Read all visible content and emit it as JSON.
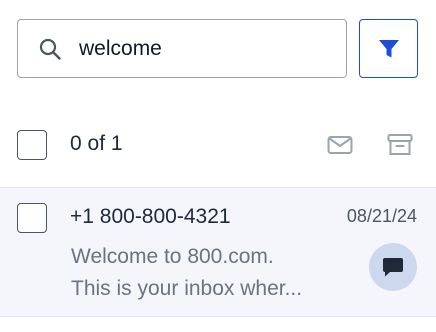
{
  "search": {
    "value": "welcome",
    "icon": "search-icon"
  },
  "filter": {
    "icon": "filter-icon",
    "color": "#1d4ed8"
  },
  "toolbar": {
    "count_label": "0 of 1",
    "icons": [
      "mail-icon",
      "archive-icon"
    ]
  },
  "messages": [
    {
      "sender": "+1 800-800-4321",
      "date": "08/21/24",
      "preview_line1": "Welcome to 800.com.",
      "preview_line2": "This is your inbox wher...",
      "badge_icon": "chat-bubble-icon"
    }
  ]
}
